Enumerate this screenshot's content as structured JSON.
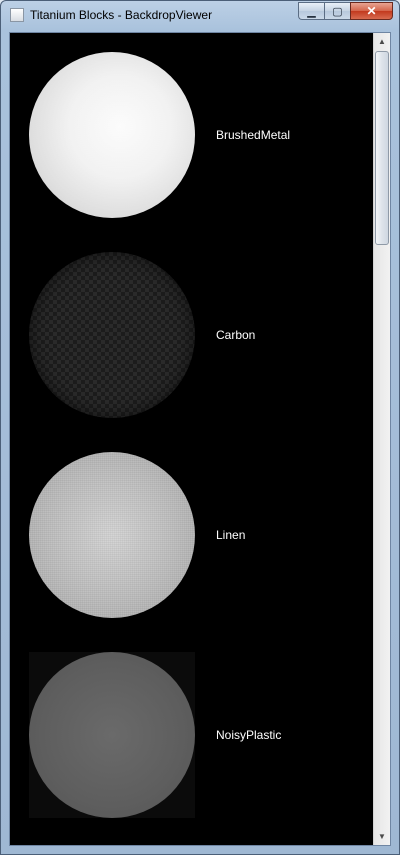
{
  "window": {
    "title": "Titanium Blocks - BackdropViewer",
    "controls": {
      "minimize": "▁",
      "maximize": "▢",
      "close": "✕"
    }
  },
  "backdrops": [
    {
      "name": "BrushedMetal"
    },
    {
      "name": "Carbon"
    },
    {
      "name": "Linen"
    },
    {
      "name": "NoisyPlastic"
    }
  ],
  "scrollbar": {
    "up_icon": "▲",
    "down_icon": "▼"
  }
}
